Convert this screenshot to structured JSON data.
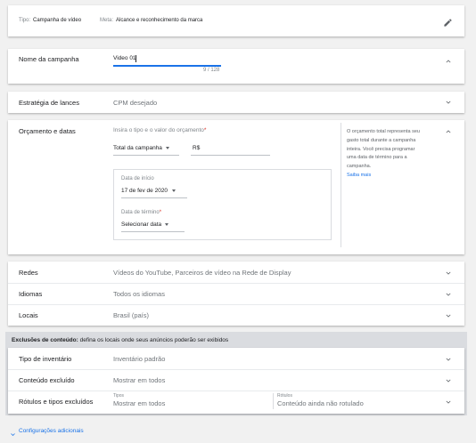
{
  "summary": {
    "type_label": "Tipo:",
    "type_value": "Campanha de vídeo",
    "goal_label": "Meta:",
    "goal_value": "Alcance e reconhecimento da marca"
  },
  "name_section": {
    "label": "Nome da campanha",
    "value": "Video 01",
    "counter": "9 / 128"
  },
  "bidding": {
    "label": "Estratégia de lances",
    "value": "CPM desejado"
  },
  "budget": {
    "label": "Orçamento e datas",
    "hint": "Insira o tipo e o valor do orçamento",
    "required_mark": "*",
    "type_selected": "Total da campanha",
    "currency": "R$",
    "start_label": "Data de início",
    "start_value": "17 de fev de 2020",
    "end_label": "Data de término",
    "end_required": "*",
    "end_value": "Selecionar data",
    "help_lines": [
      "O orçamento total representa seu",
      "gasto total durante a campanha",
      "inteira. Você precisa programar",
      "uma data de término para a",
      "campanha."
    ],
    "help_link": "Saiba mais"
  },
  "rows": [
    {
      "label": "Redes",
      "value": "Vídeos do YouTube, Parceiros de vídeo na Rede de Display"
    },
    {
      "label": "Idiomas",
      "value": "Todos os idiomas"
    },
    {
      "label": "Locais",
      "value": "Brasil (país)"
    }
  ],
  "exclusions": {
    "title_bold": "Exclusões de conteúdo:",
    "title_rest": " defina os locais onde seus anúncios poderão ser exibidos",
    "rows": [
      {
        "label": "Tipo de inventário",
        "value": "Inventário padrão"
      },
      {
        "label": "Conteúdo excluído",
        "value": "Mostrar em todos"
      }
    ],
    "labels_row": {
      "label": "Rótulos e tipos excluídos",
      "types_caption": "Tipos",
      "types_value": "Mostrar em todos",
      "labels_caption": "Rótulos",
      "labels_value": "Conteúdo ainda não rotulado"
    }
  },
  "footer": {
    "link": "Configurações adicionais"
  },
  "colors": {
    "link": "#1a73e8",
    "required": "#d93025",
    "focus_underline": "#1a73e8",
    "exclusion_band": "#dadce0"
  }
}
